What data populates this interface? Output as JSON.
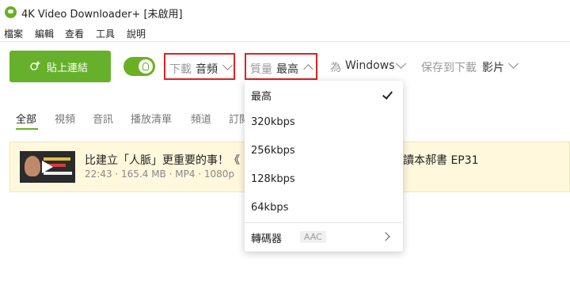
{
  "window": {
    "title": "4K Video Downloader+ [未啟用]"
  },
  "menu": [
    "檔案",
    "編輯",
    "查看",
    "工具",
    "說明"
  ],
  "toolbar": {
    "paste_label": "貼上連結",
    "smart_mode_enabled": true,
    "download": {
      "label": "下載",
      "value": "音頻"
    },
    "quality": {
      "label": "質量",
      "value": "最高"
    },
    "platform": {
      "label": "為",
      "value": "Windows"
    },
    "save_to": {
      "label": "保存到下載",
      "value": "影片"
    }
  },
  "tabs": [
    "全部",
    "視頻",
    "音訊",
    "播放清單",
    "頻道",
    "訂閱"
  ],
  "video": {
    "title": "比建立「人脈」更重要的事！《",
    "title_end": "讀本郝書 EP31",
    "meta": "22:43 · 165.4 MB · MP4 · 1080p"
  },
  "quality_dropdown": {
    "options": [
      "最高",
      "320kbps",
      "256kbps",
      "128kbps",
      "64kbps"
    ],
    "selected": "最高",
    "converter": {
      "label": "轉碼器",
      "badge": "AAC"
    }
  },
  "colors": {
    "accent": "#66b02b",
    "highlight_box": "#e02020",
    "row_bg": "#fff8dc"
  }
}
